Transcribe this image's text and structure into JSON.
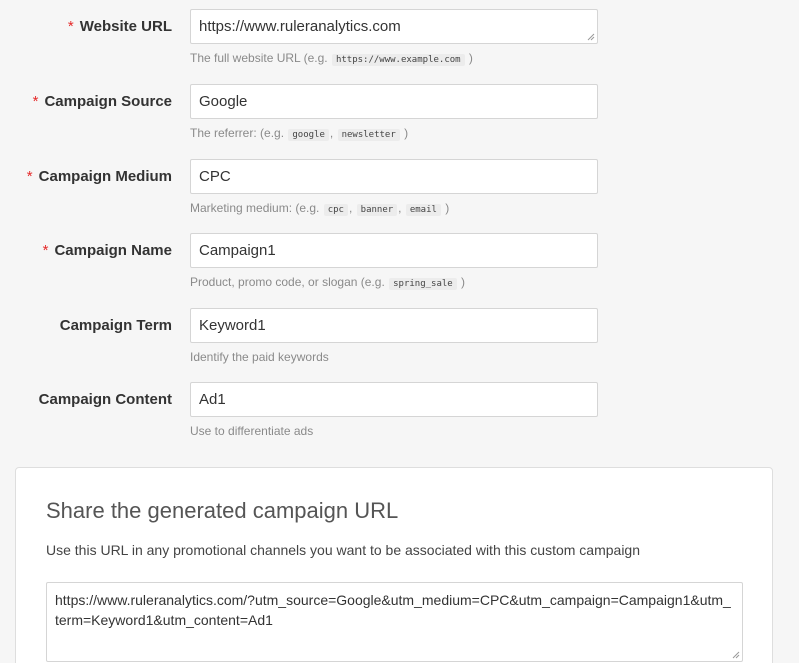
{
  "fields": [
    {
      "label": "Website URL",
      "required": true,
      "value": "https://www.ruleranalytics.com",
      "help_prefix": "The full website URL (e.g. ",
      "help_codes": [
        "https://www.example.com"
      ],
      "help_suffix": " )"
    },
    {
      "label": "Campaign Source",
      "required": true,
      "value": "Google",
      "help_prefix": "The referrer: (e.g. ",
      "help_codes": [
        "google",
        "newsletter"
      ],
      "help_suffix": " )"
    },
    {
      "label": "Campaign Medium",
      "required": true,
      "value": "CPC",
      "help_prefix": "Marketing medium: (e.g. ",
      "help_codes": [
        "cpc",
        "banner",
        "email"
      ],
      "help_suffix": " )"
    },
    {
      "label": "Campaign Name",
      "required": true,
      "value": "Campaign1",
      "help_prefix": "Product, promo code, or slogan (e.g. ",
      "help_codes": [
        "spring_sale"
      ],
      "help_suffix": " )"
    },
    {
      "label": "Campaign Term",
      "required": false,
      "value": "Keyword1",
      "help_prefix": "Identify the paid keywords",
      "help_codes": [],
      "help_suffix": ""
    },
    {
      "label": "Campaign Content",
      "required": false,
      "value": "Ad1",
      "help_prefix": "Use to differentiate ads",
      "help_codes": [],
      "help_suffix": ""
    }
  ],
  "required_marker": "*",
  "share": {
    "title": "Share the generated campaign URL",
    "description": "Use this URL in any promotional channels you want to be associated with this custom campaign",
    "url": "https://www.ruleranalytics.com/?utm_source=Google&utm_medium=CPC&utm_campaign=Campaign1&utm_term=Keyword1&utm_content=Ad1"
  },
  "colors": {
    "required": "#e52929",
    "background": "#f6f6f6"
  }
}
